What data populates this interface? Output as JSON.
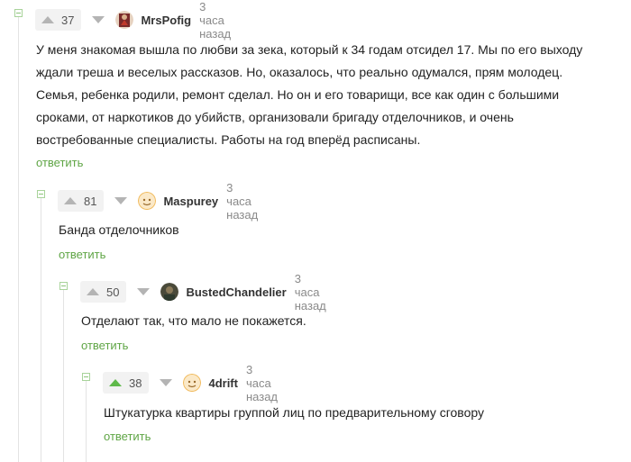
{
  "comments": [
    {
      "votes": "37",
      "username": "MrsPofig",
      "time": "3 часа назад",
      "text_lines": [
        "У меня знакомая вышла по любви за зека, который к 34 годам отсидел 17. Мы по его выходу",
        "ждали треша и веселых рассказов. Но, оказалось, что реально одумался, прям молодец.",
        "Семья, ребенка родили, ремонт сделал. Но он и его товарищи, все как один с большими",
        "сроками, от наркотиков до убийств, организовали бригаду отделочников, и очень",
        "востребованные специалисты. Работы на год вперёд расписаны."
      ],
      "reply_label": "ответить",
      "upvoted": false,
      "avatar_icon": "user-avatar-icon"
    },
    {
      "votes": "81",
      "username": "Maspurey",
      "time": "3 часа назад",
      "text_lines": [
        "Банда отделочников"
      ],
      "reply_label": "ответить",
      "upvoted": false,
      "avatar_icon": "user-avatar-icon"
    },
    {
      "votes": "50",
      "username": "BustedChandelier",
      "time": "3 часа назад",
      "text_lines": [
        "Отделают так, что мало не покажется."
      ],
      "reply_label": "ответить",
      "upvoted": false,
      "avatar_icon": "user-avatar-icon"
    },
    {
      "votes": "38",
      "username": "4drift",
      "time": "3 часа назад",
      "text_lines": [
        "Штукатурка квартиры группой лиц по предварительному сговору"
      ],
      "reply_label": "ответить",
      "upvoted": true,
      "avatar_icon": "user-avatar-icon"
    }
  ],
  "colors": {
    "accent_green": "#5fb94a",
    "link_green": "#5fa545",
    "vote_bg": "#f2f2f2",
    "muted": "#8a8a8a"
  }
}
